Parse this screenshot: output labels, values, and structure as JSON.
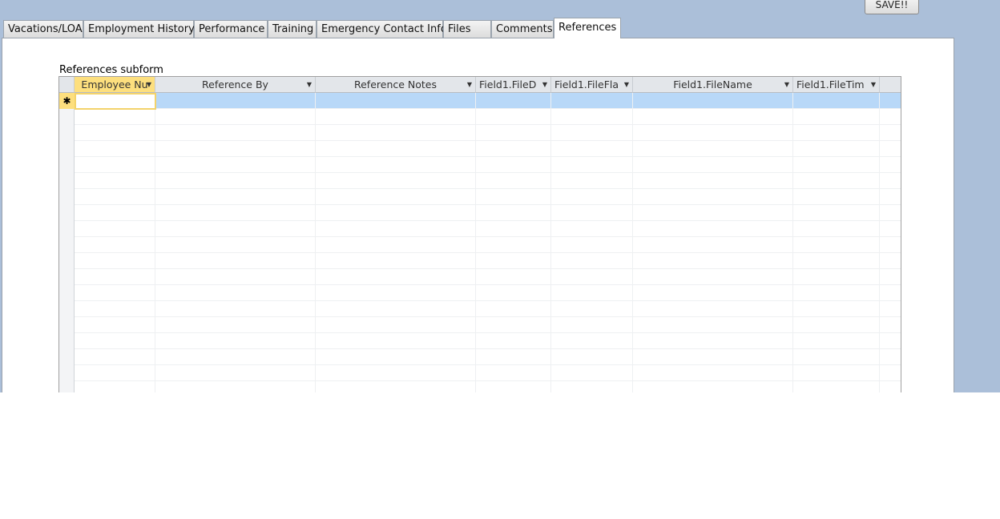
{
  "save_button": "SAVE!!",
  "tabs": [
    "Vacations/LOA",
    "Employment History",
    "Performance",
    "Training",
    "Emergency Contact Info",
    "Files",
    "Comments",
    "References"
  ],
  "active_tab": "References",
  "subform_label": "References subform",
  "columns": [
    "Employee Nu",
    "Reference By",
    "Reference Notes",
    "Field1.FileD",
    "Field1.FileFla",
    "Field1.FileName",
    "Field1.FileTim"
  ],
  "new_record_marker": "✱",
  "colors": {
    "background": "#abbfd9",
    "selected_row": "#b8d8f8",
    "selected_header": "#fddf7e"
  }
}
